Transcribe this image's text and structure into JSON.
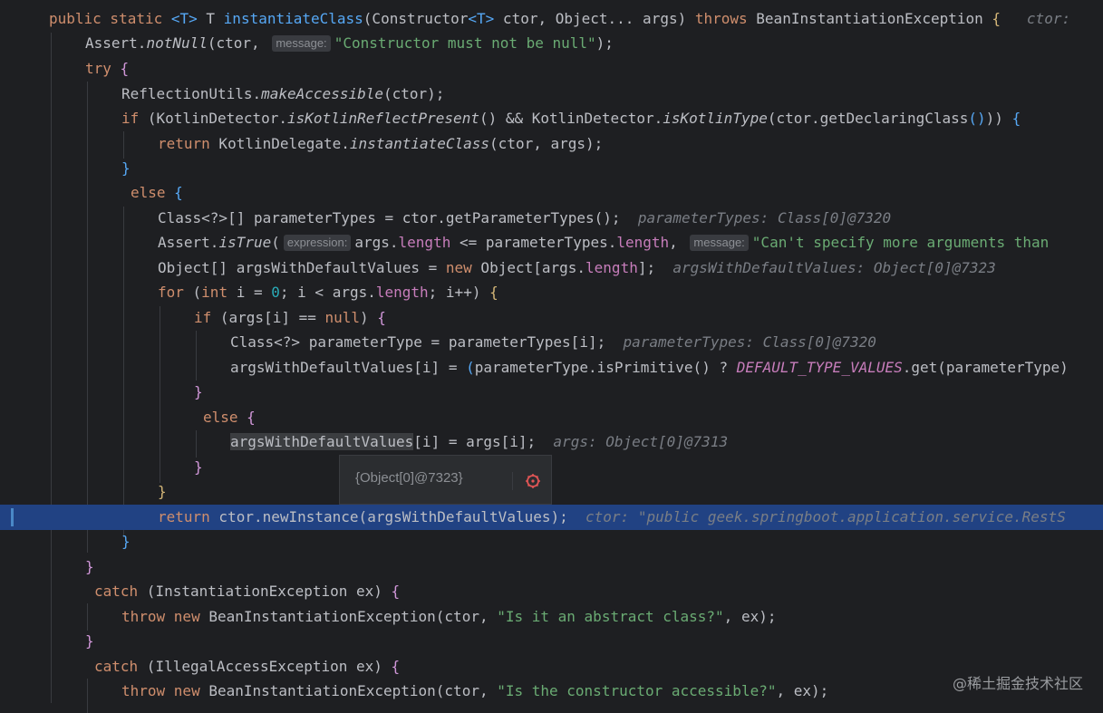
{
  "lines": [
    "public static <T> T instantiateClass(Constructor<T> ctor, Object... args) throws BeanInstantiationException {",
    "Assert.notNull(ctor, \"Constructor must not be null\");",
    "try {",
    "ReflectionUtils.makeAccessible(ctor);",
    "if (KotlinDetector.isKotlinReflectPresent() && KotlinDetector.isKotlinType(ctor.getDeclaringClass())) {",
    "return KotlinDelegate.instantiateClass(ctor, args);",
    "}",
    "else {",
    "Class<?>[] parameterTypes = ctor.getParameterTypes();",
    "Assert.isTrue(args.length <= parameterTypes.length, \"Can't specify more arguments than",
    "Object[] argsWithDefaultValues = new Object[args.length];",
    "for (int i = 0; i < args.length; i++) {",
    "if (args[i] == null) {",
    "Class<?> parameterType = parameterTypes[i];",
    "argsWithDefaultValues[i] = (parameterType.isPrimitive() ? DEFAULT_TYPE_VALUES.get(parameterType)",
    "}",
    "else {",
    "argsWithDefaultValues[i] = args[i];",
    "}",
    "}",
    "return ctor.newInstance(argsWithDefaultValues);",
    "}",
    "}",
    "catch (InstantiationException ex) {",
    "throw new BeanInstantiationException(ctor, \"Is it an abstract class?\", ex);",
    "}",
    "catch (IllegalAccessException ex) {",
    "throw new BeanInstantiationException(ctor, \"Is the constructor accessible?\", ex);"
  ],
  "inlay": {
    "message": "message:",
    "expression": "expression:",
    "ctor_hint": "ctor:",
    "parameterTypes_hint": "parameterTypes: Class[0]@7320",
    "argsWithDefaultValues_hint": "argsWithDefaultValues: Object[0]@7323",
    "args_hint": "args: Object[0]@7313",
    "exec_hint": "ctor: \"public geek.springboot.application.service.RestS"
  },
  "popup": {
    "value": "{Object[0]@7323}",
    "icon": "bug-debug-icon"
  },
  "watermark": "@稀土掘金技术社区",
  "colors": {
    "background": "#1e1f22",
    "execution_line": "#214283",
    "keyword": "#cf8e6d",
    "method": "#56a8f5",
    "string": "#6aab73",
    "number": "#2aacb8",
    "constant": "#c77dbb"
  }
}
